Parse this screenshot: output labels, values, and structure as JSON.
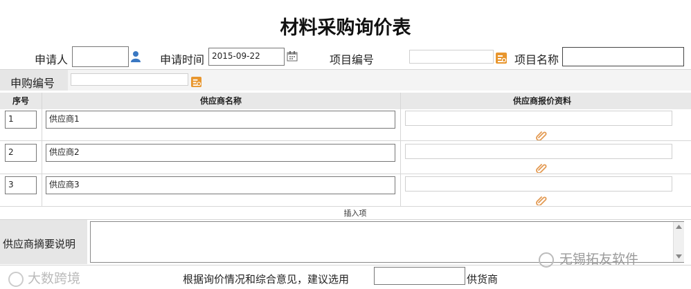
{
  "form": {
    "title": "材料采购询价表",
    "applicant_label": "申请人",
    "applicant_value": "",
    "apply_time_label": "申请时间",
    "apply_time_value": "2015-09-22",
    "project_no_label": "项目编号",
    "project_no_value": "",
    "project_name_label": "项目名称",
    "project_name_value": "",
    "purchase_no_label": "申购编号",
    "purchase_no_value": ""
  },
  "table": {
    "headers": [
      "序号",
      "供应商名称",
      "供应商报价资料"
    ],
    "rows": [
      {
        "seq": "1",
        "supplier": "供应商1",
        "quote": ""
      },
      {
        "seq": "2",
        "supplier": "供应商2",
        "quote": ""
      },
      {
        "seq": "3",
        "supplier": "供应商3",
        "quote": ""
      }
    ],
    "insert_label": "插入项"
  },
  "summary": {
    "label": "供应商摘要说明",
    "value": ""
  },
  "recommend": {
    "prefix": "根据询价情况和综合意见，建议选用",
    "value": "",
    "suffix": "供货商"
  },
  "watermarks": {
    "left": "大数跨境",
    "right": "无锡拓友软件"
  },
  "colors": {
    "header_bg": "#e8e8e8",
    "accent_orange": "#e8962e",
    "user_icon_blue": "#3a78c2"
  },
  "icons": [
    "user-icon",
    "calendar-icon",
    "lookup-icon",
    "paperclip-icon",
    "scroll-up-icon",
    "scroll-down-icon"
  ]
}
